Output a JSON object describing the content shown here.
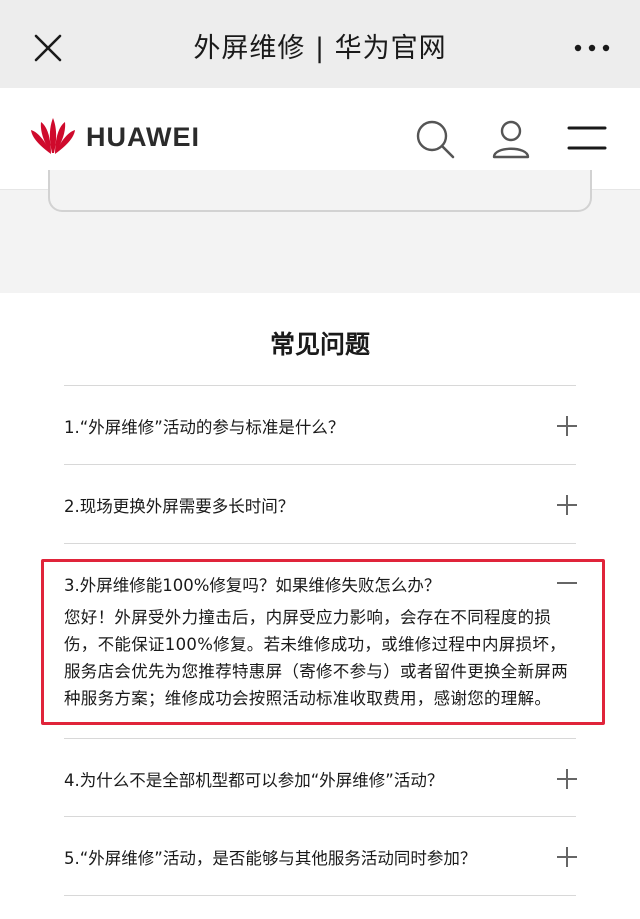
{
  "titlebar": {
    "title": "外屏维修 | 华为官网",
    "close_icon": "close-icon",
    "more_icon": "more-dots-icon"
  },
  "navbar": {
    "brand": "HUAWEI",
    "brand_color": "#cf0a2c",
    "icons": [
      "search-icon",
      "user-icon",
      "menu-icon"
    ]
  },
  "faq": {
    "title": "常见问题",
    "items": [
      {
        "question": "1.“外屏维修”活动的参与标准是什么？",
        "expanded": false
      },
      {
        "question": "2.现场更换外屏需要多长时间？",
        "expanded": false
      },
      {
        "question": "3.外屏维修能100%修复吗？如果维修失败怎么办？",
        "expanded": true,
        "answer_lines": [
          "您好！外屏受外力撞击后，内屏受应力影响，会存在不同程度的损",
          "伤，不能保证100%修复。若未维修成功，或维修过程中内屏损坏，",
          "服务店会优先为您推荐特惠屏（寄修不参与）或者留件更换全新屏两",
          "种服务方案；维修成功会按照活动标准收取费用，感谢您的理解。"
        ]
      },
      {
        "question": "4.为什么不是全部机型都可以参加“外屏维修”活动？",
        "expanded": false
      },
      {
        "question": "5.“外屏维修”活动，是否能够与其他服务活动同时参加？",
        "expanded": false
      }
    ],
    "highlight_color": "#e0243a"
  }
}
